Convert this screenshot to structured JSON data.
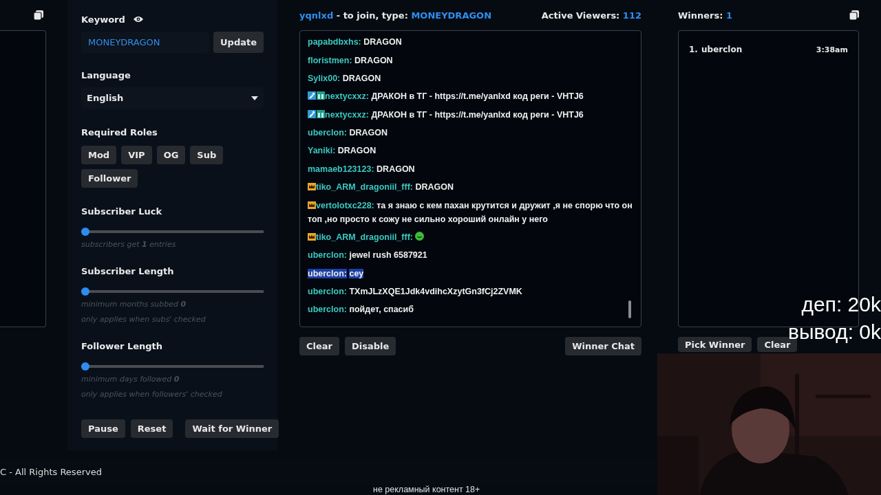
{
  "settings": {
    "keyword_label": "Keyword",
    "keyword_value": "MONEYDRAGON",
    "update_button": "Update",
    "language_label": "Language",
    "language_value": "English",
    "roles_label": "Required Roles",
    "roles": [
      "Mod",
      "VIP",
      "OG",
      "Sub",
      "Follower"
    ],
    "sliders": [
      {
        "label": "Subscriber Luck",
        "level": 0,
        "notes": [
          "subscribers get **1** entries"
        ]
      },
      {
        "label": "Subscriber Length",
        "level": 0,
        "notes": [
          "minimum months subbed **0**",
          "only applies when subs' checked"
        ]
      },
      {
        "label": "Follower Length",
        "level": 0,
        "notes": [
          "minimum days followed **0**",
          "only applies when followers' checked"
        ]
      }
    ],
    "buttons": [
      "Pause",
      "Reset",
      "Wait for Winner"
    ]
  },
  "chat": {
    "channel": "yqnlxd",
    "join_text": "- to join, type:",
    "keyword": "MONEYDRAGON",
    "viewers_label": "Active Viewers:",
    "viewers": "112",
    "messages": [
      {
        "kind": "plain",
        "user": "papabdbxhs:",
        "text": "DRAGON",
        "selected": false
      },
      {
        "kind": "plain",
        "user": "floristmen:",
        "text": "DRAGON",
        "selected": false
      },
      {
        "kind": "plain",
        "user": "Sylix00:",
        "text": "DRAGON",
        "selected": false
      },
      {
        "kind": "moderator",
        "user": "nextycxxz:",
        "text": "ДРАКОН в ТГ - https://t.me/yanlxd код реги - VHTJ6",
        "selected": false
      },
      {
        "kind": "moderator",
        "user": "nextycxxz:",
        "text": "ДРАКОН в ТГ - https://t.me/yanlxd код реги - VHTJ6",
        "selected": false
      },
      {
        "kind": "plain",
        "user": "uberclon:",
        "text": "DRAGON",
        "selected": false
      },
      {
        "kind": "plain",
        "user": "Yaniki:",
        "text": "DRAGON",
        "selected": false
      },
      {
        "kind": "plain",
        "user": "mamaeb123123:",
        "text": "DRAGON",
        "selected": false
      },
      {
        "kind": "crowned",
        "user": "tiko_ARM_dragoniil_fff:",
        "text": "DRAGON",
        "selected": false
      },
      {
        "kind": "crowned",
        "user": "vertolotxc228:",
        "text": "та я знаю с кем пахан крутится и дружит ,я не спорю что он топ ,но просто к сожу не сильно хороший онлайн у него",
        "selected": false
      },
      {
        "kind": "crowned",
        "user": "tiko_ARM_dragoniil_fff:",
        "emote": true,
        "selected": false
      },
      {
        "kind": "plain",
        "user": "uberclon:",
        "text": "jewel rush 6587921",
        "selected": false
      },
      {
        "kind": "plain",
        "user": "uberclon:",
        "text": "cey",
        "selected": true
      },
      {
        "kind": "plain",
        "user": "uberclon:",
        "text": "TXmJLzXQE1Jdk4vdihcXzytGn3fCj2ZVMK",
        "selected": false
      },
      {
        "kind": "plain",
        "user": "uberclon:",
        "text": "пойдет, спасиб",
        "selected": false
      }
    ],
    "buttons": [
      "Clear",
      "Disable"
    ],
    "winner_chat_button": "Winner Chat"
  },
  "winners": {
    "label": "Winners:",
    "count": "1",
    "list": [
      {
        "rank": "1.",
        "name": "uberclon",
        "time": "3:38am"
      }
    ],
    "buttons": [
      "Pick Winner",
      "Clear"
    ]
  },
  "footer": "C - All Rights Reserved",
  "stream_overlay": {
    "lines": [
      "деп: 20k",
      "вывод: 0k"
    ],
    "webcam": {
      "kind": "picture"
    },
    "caption": "не рекламный контент 18+"
  }
}
